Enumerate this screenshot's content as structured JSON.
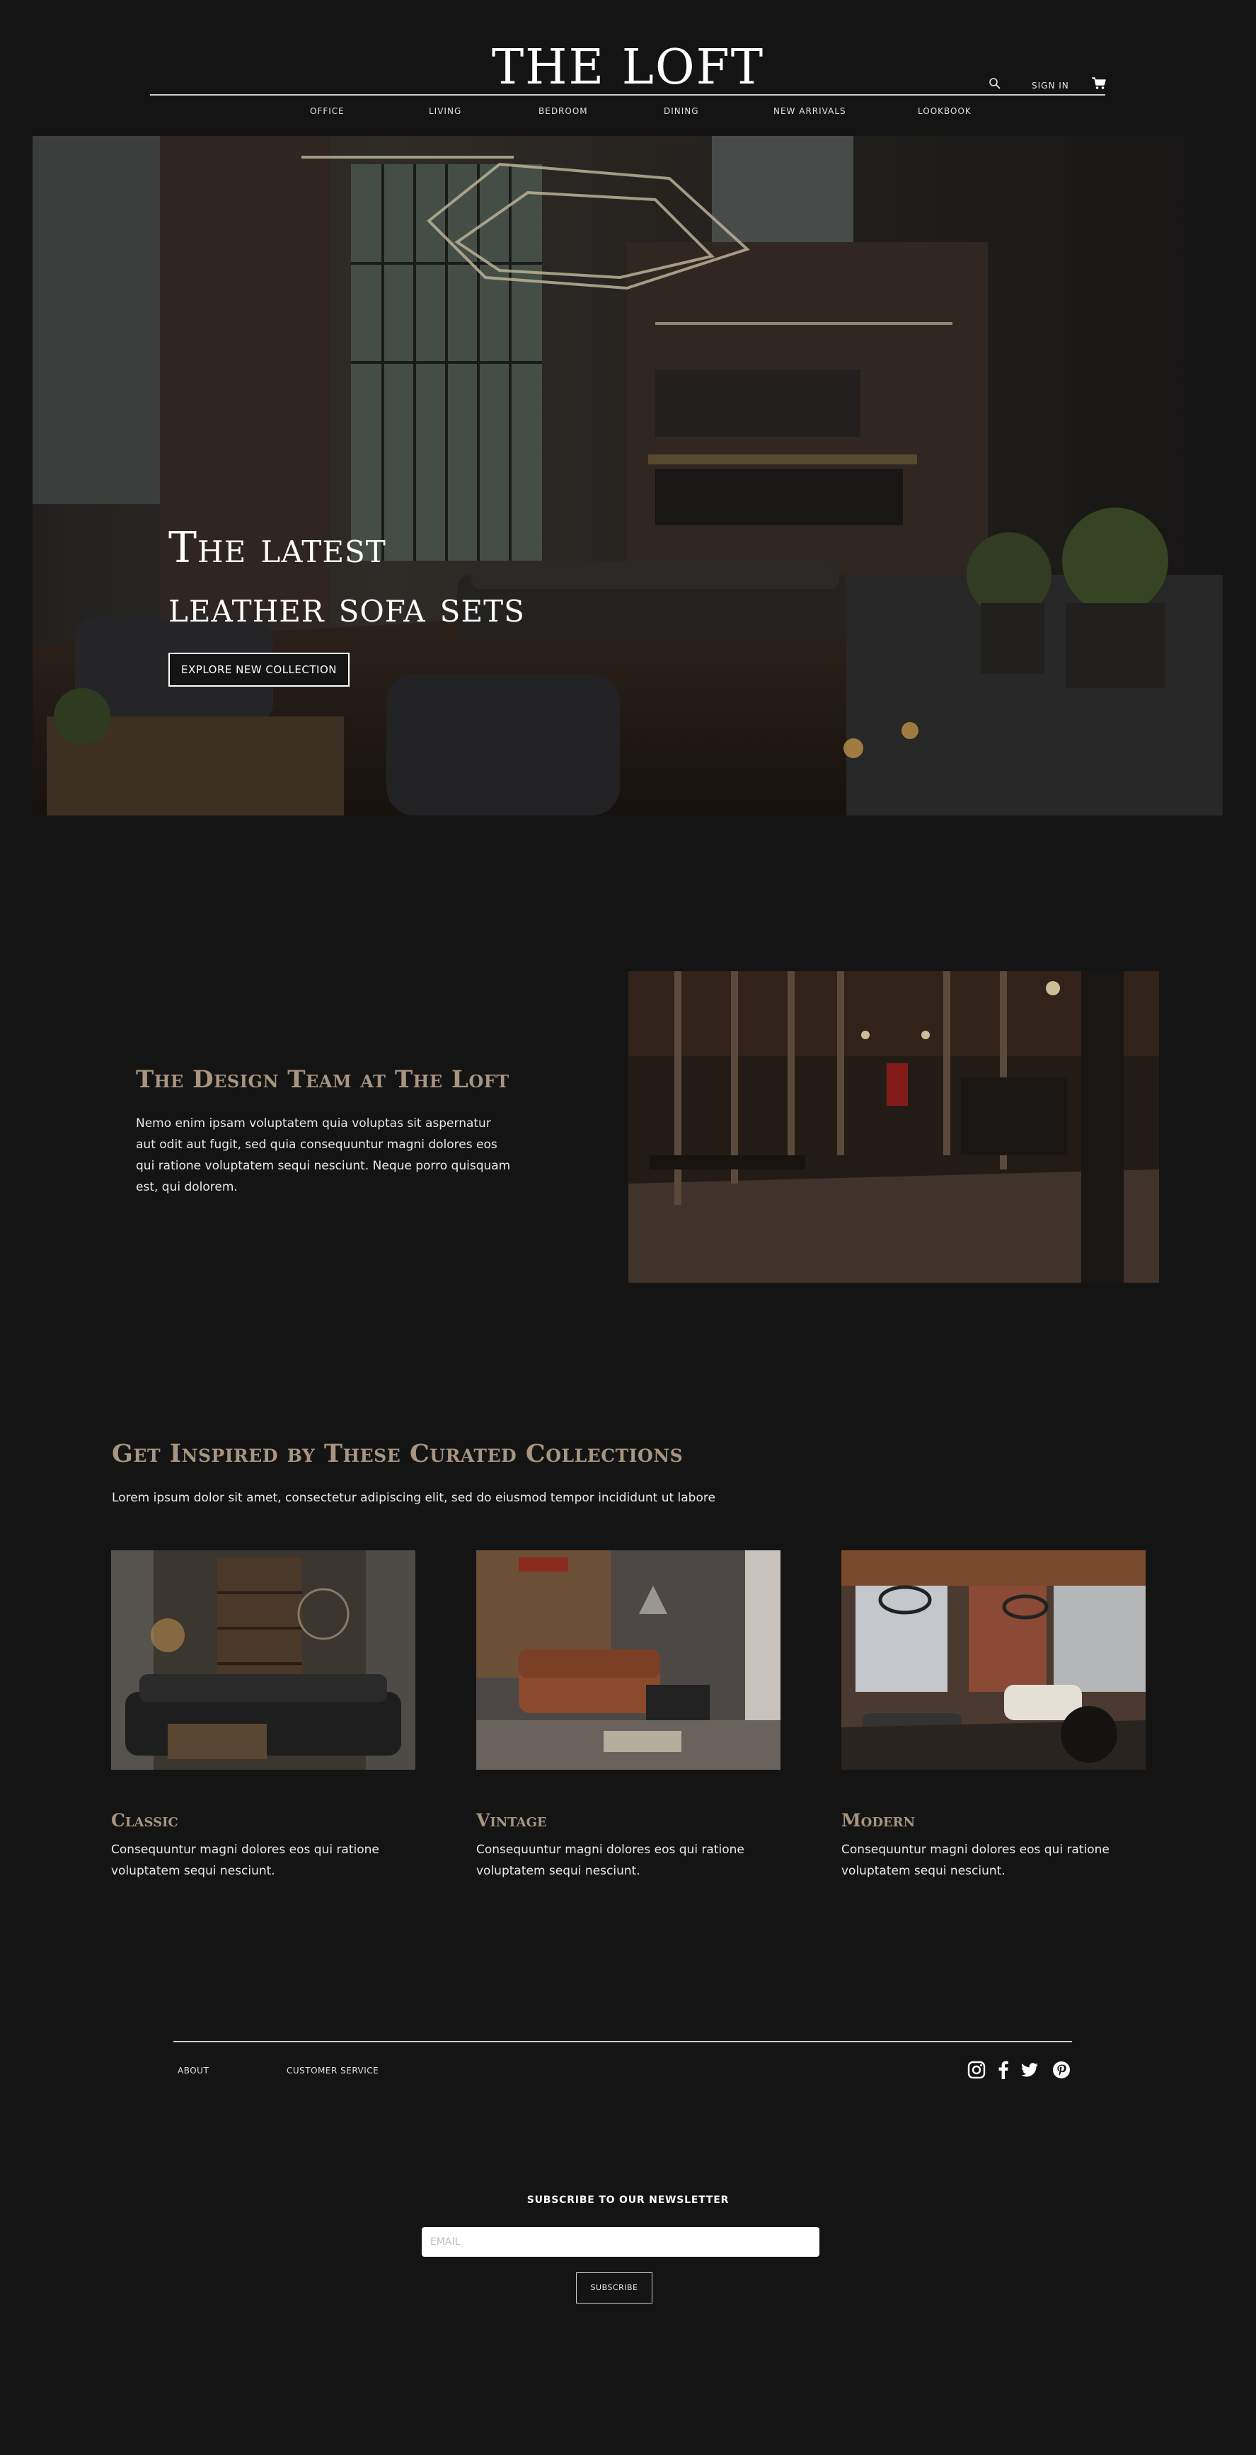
{
  "header": {
    "logo": "THE LOFT",
    "sign_in": "SIGN IN",
    "icons": {
      "search": "search-icon",
      "cart": "cart-icon"
    }
  },
  "nav": {
    "items": [
      {
        "label": "OFFICE"
      },
      {
        "label": "LIVING"
      },
      {
        "label": "BEDROOM"
      },
      {
        "label": "DINING"
      },
      {
        "label": "NEW ARRIVALS"
      },
      {
        "label": "LOOKBOOK"
      }
    ]
  },
  "hero": {
    "title_line1": "The latest",
    "title_line2": "leather sofa sets",
    "button_label": "EXPLORE NEW COLLECTION"
  },
  "design_team": {
    "title": "The Design Team at The Loft",
    "body": "Nemo enim ipsam voluptatem quia voluptas sit aspernatur aut odit aut fugit, sed quia consequuntur magni dolores eos qui ratione voluptatem sequi nesciunt. Neque porro quisquam est, qui dolorem."
  },
  "collections": {
    "title": "Get Inspired by These Curated Collections",
    "subtitle": "Lorem ipsum dolor sit amet, consectetur adipiscing elit, sed do eiusmod tempor incididunt ut labore",
    "cards": [
      {
        "name": "Classic",
        "text": "Consequuntur magni dolores eos qui ratione voluptatem sequi nesciunt."
      },
      {
        "name": "Vintage",
        "text": "Consequuntur magni dolores eos qui ratione voluptatem sequi nesciunt."
      },
      {
        "name": "Modern",
        "text": "Consequuntur magni dolores eos qui ratione voluptatem sequi nesciunt."
      }
    ]
  },
  "footer": {
    "about": "ABOUT",
    "customer_service": "CUSTOMER SERVICE",
    "social_icons": [
      "instagram-icon",
      "facebook-icon",
      "twitter-icon",
      "pinterest-icon"
    ],
    "newsletter_title": "SUBSCRIBE TO OUR NEWSLETTER",
    "email_placeholder": "EMAIL",
    "subscribe_label": "SUBSCRIBE"
  },
  "colors": {
    "background": "#141414",
    "accent": "#a89580",
    "text": "#e8e8e8"
  }
}
